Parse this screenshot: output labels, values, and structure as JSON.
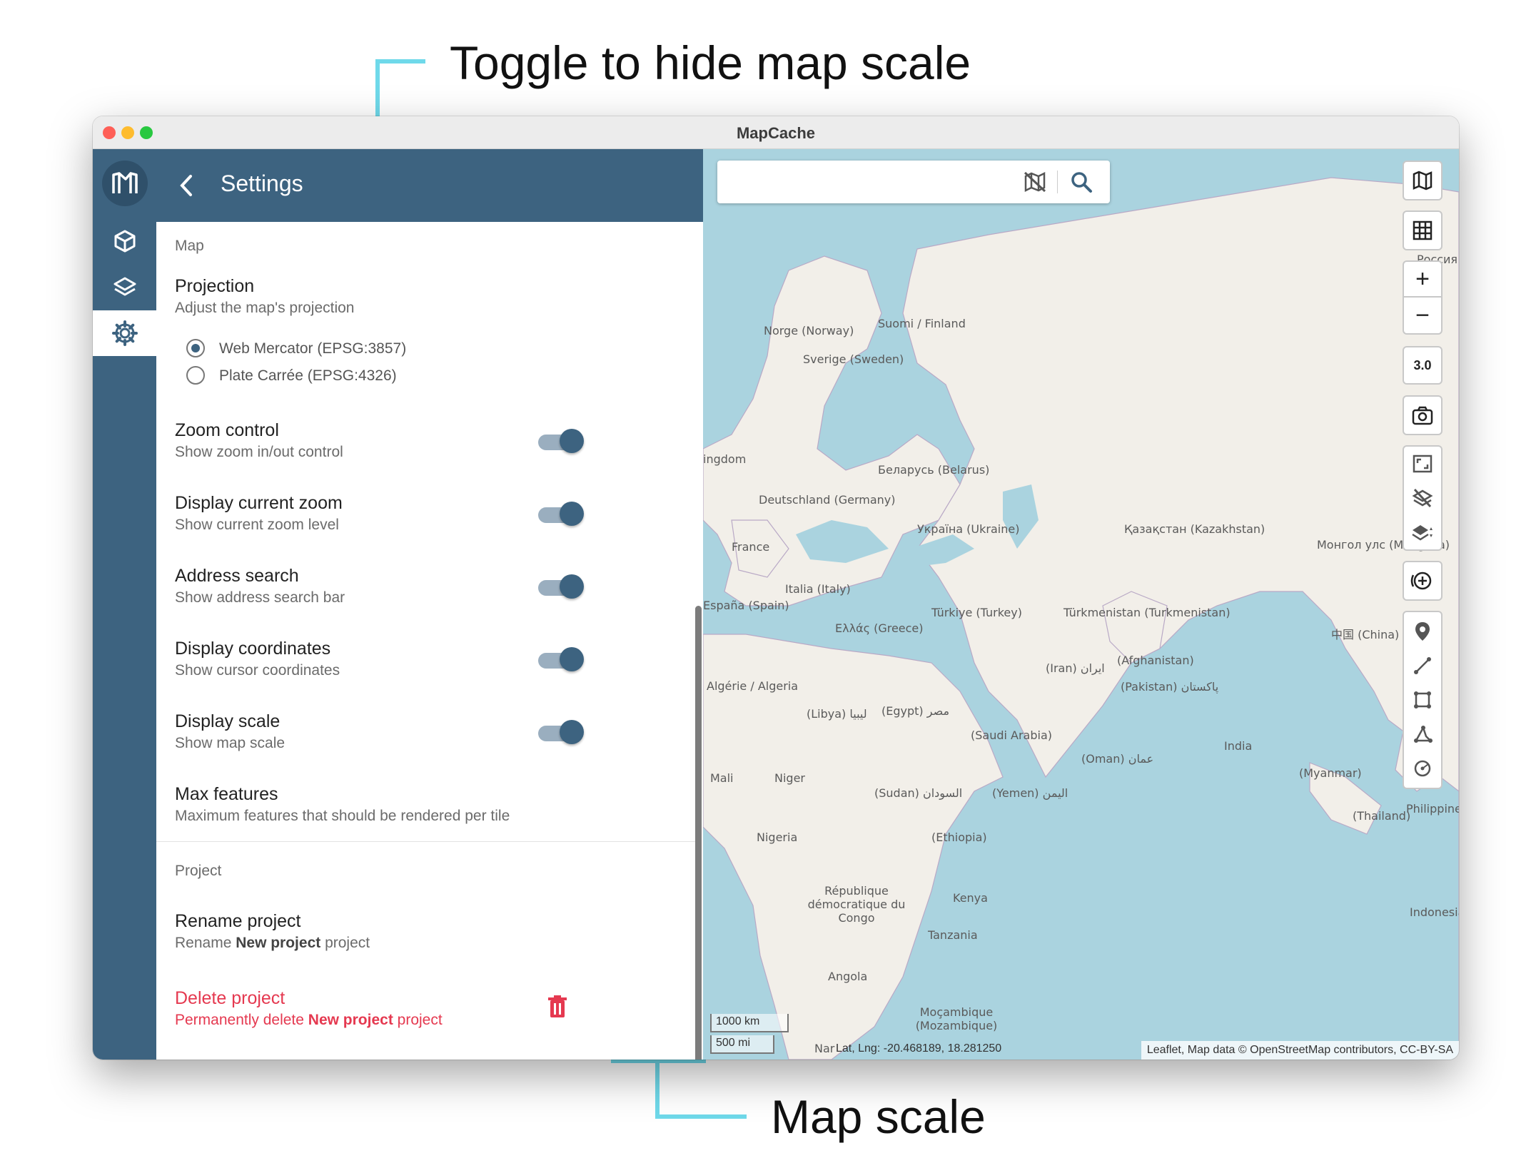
{
  "annotations": {
    "top_label": "Toggle to hide map scale",
    "bottom_label": "Map scale",
    "accent": "#6fd9ea"
  },
  "window": {
    "title": "MapCache",
    "traffic_lights": [
      "#fe5f57",
      "#febc2e",
      "#28c840"
    ]
  },
  "rail": {
    "logo_icon": "mapcache-logo-icon",
    "items": [
      {
        "icon": "cube-icon",
        "active": false
      },
      {
        "icon": "layers-icon",
        "active": false
      },
      {
        "icon": "gear-icon",
        "active": true
      }
    ]
  },
  "settings": {
    "header_title": "Settings",
    "map_section": "Map",
    "projection": {
      "title": "Projection",
      "subtitle": "Adjust the map's projection",
      "options": [
        "Web Mercator (EPSG:3857)",
        "Plate Carrée (EPSG:4326)"
      ],
      "selected": 0
    },
    "toggles": [
      {
        "title": "Zoom control",
        "subtitle": "Show zoom in/out control",
        "on": true
      },
      {
        "title": "Display current zoom",
        "subtitle": "Show current zoom level",
        "on": true
      },
      {
        "title": "Address search",
        "subtitle": "Show address search bar",
        "on": true
      },
      {
        "title": "Display coordinates",
        "subtitle": "Show cursor coordinates",
        "on": true
      },
      {
        "title": "Display scale",
        "subtitle": "Show map scale",
        "on": true
      }
    ],
    "max_features": {
      "title": "Max features",
      "subtitle": "Maximum features that should be rendered per tile"
    },
    "project_section": "Project",
    "rename": {
      "title": "Rename project",
      "sub_pre": "Rename ",
      "sub_bold": "New project",
      "sub_post": " project"
    },
    "delete": {
      "title": "Delete project",
      "sub_pre": "Permanently delete ",
      "sub_bold": "New project",
      "sub_post": " project",
      "color": "#e53950"
    }
  },
  "map": {
    "search_placeholder": "",
    "zoom_level": "3.0",
    "coords": "Lat, Lng: -20.468189, 18.281250",
    "coords_prefix": "Nar",
    "scale_km": "1000 km",
    "scale_mi": "500 mi",
    "attribution": "Leaflet, Map data © OpenStreetMap contributors, CC-BY-SA",
    "labels": [
      "Norge (Norway)",
      "Suomi / Finland",
      "Sverige (Sweden)",
      "Россия (Ru",
      "ingdom",
      "Беларусь (Belarus)",
      "Deutschland (Germany)",
      "Україна (Ukraine)",
      "Қазақстан (Kazakhstan)",
      "Монгол улс (Mongolia)",
      "France",
      "Italia (Italy)",
      "España (Spain)",
      "Türkiye (Turkey)",
      "Ελλάς (Greece)",
      "Türkmenistan (Turkmenistan)",
      "中国 (China)",
      "(Iran) ایران",
      "(Afghanistan)",
      "(Pakistan) پاکستان",
      "Algérie / Algeria",
      "(Libya) ليبيا",
      "(Egypt) مصر",
      "(Saudi Arabia)",
      "India",
      "(Oman) عمان",
      "Mali",
      "Niger",
      "(Sudan) السودان",
      "(Yemen) اليمن",
      "(Myanmar)",
      "(Thailand)",
      "Philippines",
      "Nigeria",
      "(Ethiopia)",
      "République démocratique du Congo",
      "Kenya",
      "Tanzania",
      "Indonesia",
      "Angola",
      "Moçambique (Mozambique)"
    ]
  }
}
